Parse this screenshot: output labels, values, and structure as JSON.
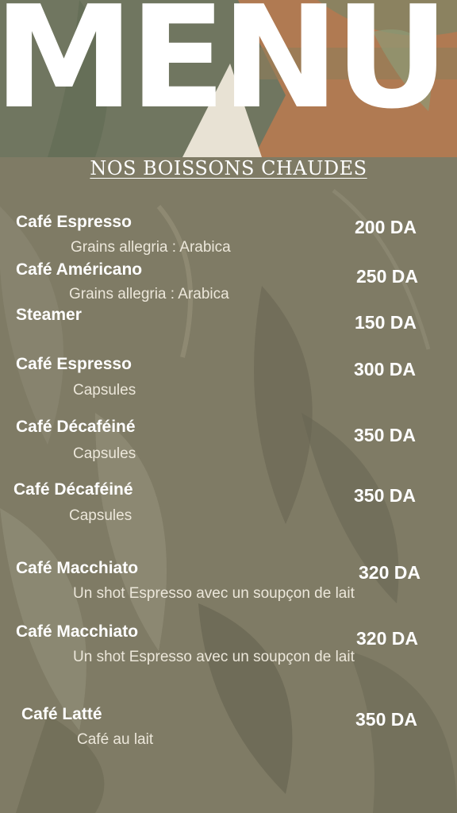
{
  "header": {
    "title": "MENU"
  },
  "section": {
    "title": "NOS BOISSONS CHAUDES"
  },
  "items": [
    {
      "name": "Café Espresso",
      "desc": "Grains allegria : Arabica",
      "price": "200 DA"
    },
    {
      "name": "Café Américano",
      "desc": "Grains allegria : Arabica",
      "price": "250 DA"
    },
    {
      "name": "Steamer",
      "desc": "",
      "price": "150 DA"
    },
    {
      "name": "Café Espresso",
      "desc": "Capsules",
      "price": "300 DA"
    },
    {
      "name": "Café Décaféiné",
      "desc": "Capsules",
      "price": "350 DA"
    },
    {
      "name": "Café Décaféiné",
      "desc": "Capsules",
      "price": "350 DA"
    },
    {
      "name": "Café Macchiato",
      "desc": "Un shot Espresso avec un soupçon de lait",
      "price": "320 DA"
    },
    {
      "name": "Café Macchiato",
      "desc": "Un shot Espresso avec un soupçon de lait",
      "price": "320 DA"
    },
    {
      "name": "Café Latté",
      "desc": "Café au lait",
      "price": "350 DA"
    }
  ],
  "colors": {
    "background": "#7d7a64",
    "header_green": "#6f7560",
    "header_orange": "#b27a52"
  }
}
